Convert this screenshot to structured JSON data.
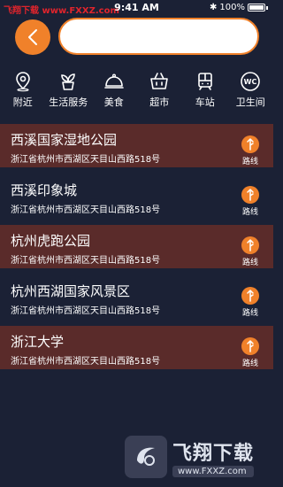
{
  "status": {
    "watermark": "飞翔下载 www.FXXZ.com",
    "time": "9:41 AM",
    "bluetooth": "✱",
    "battery_pct": "100%"
  },
  "search": {
    "value": "",
    "placeholder": ""
  },
  "categories": [
    {
      "label": "附近",
      "icon": "location-pin-icon"
    },
    {
      "label": "生活服务",
      "icon": "plant-pot-icon"
    },
    {
      "label": "美食",
      "icon": "food-cloche-icon"
    },
    {
      "label": "超市",
      "icon": "shopping-basket-icon"
    },
    {
      "label": "车站",
      "icon": "bus-icon"
    },
    {
      "label": "卫生间",
      "icon": "wc-icon"
    }
  ],
  "wc_text": "WC",
  "places": [
    {
      "name": "西溪国家湿地公园",
      "address": "浙江省杭州市西湖区天目山西路518号",
      "route_label": "路线"
    },
    {
      "name": "西溪印象城",
      "address": "浙江省杭州市西湖区天目山西路518号",
      "route_label": "路线"
    },
    {
      "name": "杭州虎跑公园",
      "address": "浙江省杭州市西湖区天目山西路518号",
      "route_label": "路线"
    },
    {
      "name": "杭州西湖国家风景区",
      "address": "浙江省杭州市西湖区天目山西路518号",
      "route_label": "路线"
    },
    {
      "name": "浙江大学",
      "address": "浙江省杭州市西湖区天目山西路518号",
      "route_label": "路线"
    }
  ],
  "logo": {
    "cn": "飞翔下载",
    "en": "www.FXXZ.com"
  },
  "colors": {
    "accent": "#f0812a",
    "background": "#1b2135",
    "row_highlight": "#5a2b2a"
  }
}
